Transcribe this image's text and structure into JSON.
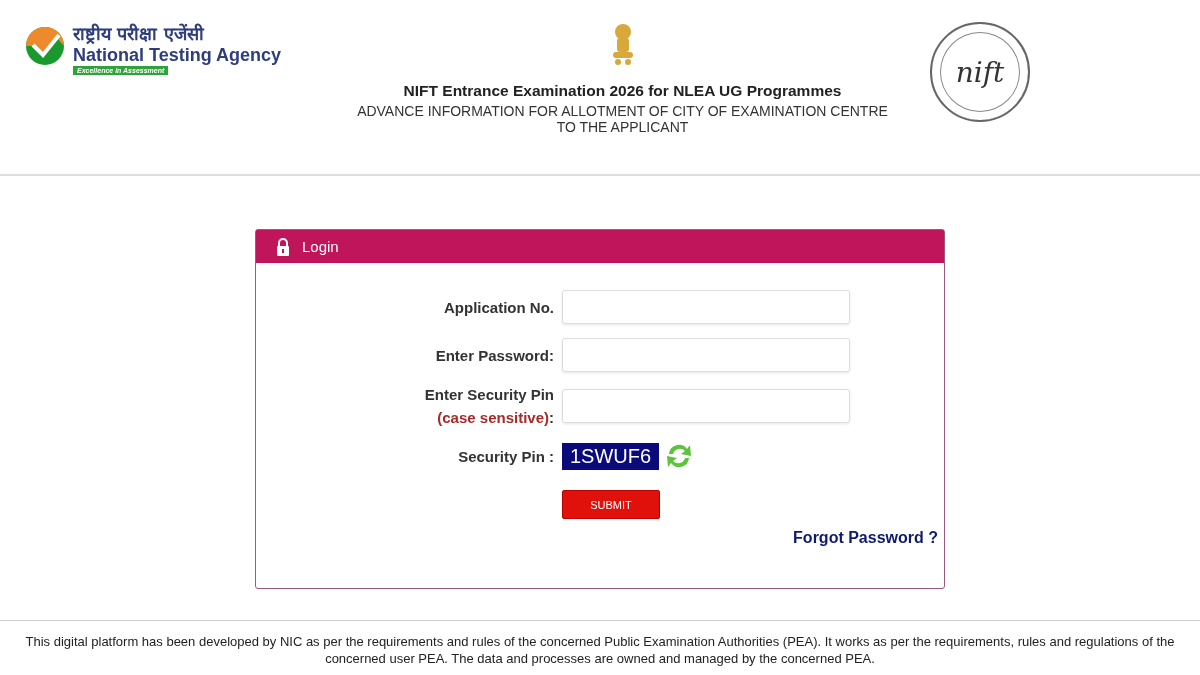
{
  "header": {
    "agency": {
      "hindi_name": "राष्ट्रीय परीक्षा एजेंसी",
      "name": "National Testing Agency",
      "tagline": "Excellence in Assessment"
    },
    "title": "NIFT Entrance Examination 2026 for NLEA UG Programmes",
    "subtitle_lines": [
      "ADVANCE INFORMATION FOR ALLOTMENT OF CITY OF EXAMINATION CENTRE",
      "TO THE APPLICANT"
    ],
    "seal_text": "nift"
  },
  "login": {
    "title": "Login",
    "fields": [
      {
        "label": "Application No."
      },
      {
        "label": "Enter Password:"
      },
      {
        "label": "Enter Security Pin",
        "note": "(case sensitive)",
        "note_suffix": ":"
      }
    ],
    "security_pin": {
      "label": "Security Pin :",
      "code": "1SWUF6"
    },
    "submit": "SUBMIT",
    "forgot": "Forgot Password ?"
  },
  "footer": "This digital platform has been developed by NIC as per the requirements and rules of the concerned Public Examination Authorities (PEA). It works as per the requirements, rules and regulations of the concerned user PEA. The data and processes are owned and managed by the concerned PEA."
}
